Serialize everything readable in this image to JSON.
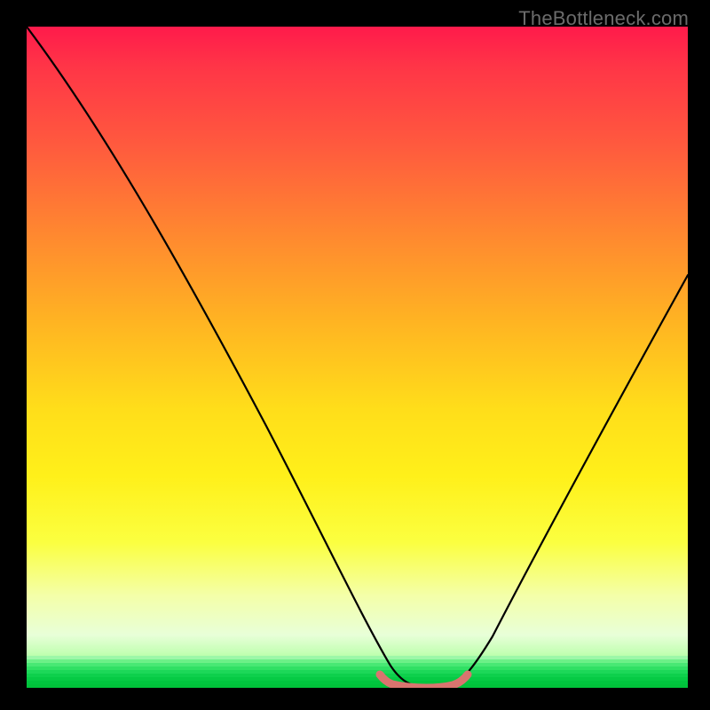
{
  "attribution": "TheBottleneck.com",
  "colors": {
    "background": "#000000",
    "gradient_top": "#ff1a4b",
    "gradient_bottom": "#00c840",
    "curve": "#000000",
    "accent_pink": "#d9746f"
  },
  "chart_data": {
    "type": "line",
    "title": "",
    "xlabel": "",
    "ylabel": "",
    "xlim": [
      0,
      100
    ],
    "ylim": [
      0,
      100
    ],
    "grid": false,
    "legend": false,
    "series": [
      {
        "name": "bottleneck-curve",
        "x": [
          0,
          5,
          10,
          15,
          20,
          25,
          30,
          35,
          40,
          45,
          50,
          52,
          54,
          56,
          58,
          60,
          62,
          64,
          66,
          70,
          75,
          80,
          85,
          90,
          95,
          100
        ],
        "y": [
          100,
          92,
          84,
          76,
          67,
          59,
          50,
          42,
          33,
          24,
          14,
          9,
          4,
          1,
          0,
          0,
          0,
          1,
          3,
          9,
          18,
          28,
          38,
          48,
          56,
          63
        ]
      },
      {
        "name": "optimal-range-highlight",
        "x": [
          54,
          56,
          58,
          60,
          62,
          64
        ],
        "y": [
          1,
          0,
          0,
          0,
          0,
          1
        ]
      }
    ],
    "annotations": []
  }
}
